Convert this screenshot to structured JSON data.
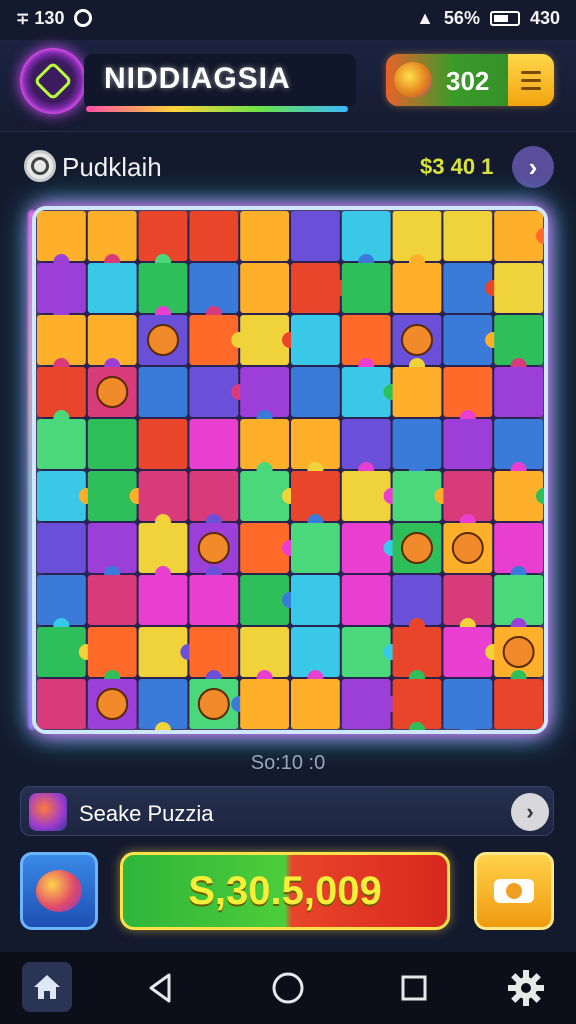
{
  "status_bar": {
    "time_left": "130",
    "battery_pct": "56%",
    "time_right": "430"
  },
  "header": {
    "title": "NIDDIAGSIA",
    "coins": "302"
  },
  "puzzle": {
    "name": "Pudklaih",
    "prize": "$3 40 1"
  },
  "timer": "So:10 :0",
  "share": {
    "label": "Seake Puzzia"
  },
  "actions": {
    "score": "S,30.5,009"
  },
  "colors": {
    "background": "#141a2e",
    "accent_pink": "#ff5cf0",
    "accent_cyan": "#38e6ff",
    "score_text": "#f6ef3a"
  },
  "icons": [
    "logo-icon",
    "coin-icon",
    "menu-icon",
    "next-icon",
    "share-icon",
    "powerup-icon",
    "camera-icon",
    "home-icon",
    "back-icon",
    "circle-home-icon",
    "recents-icon",
    "gear-icon"
  ]
}
